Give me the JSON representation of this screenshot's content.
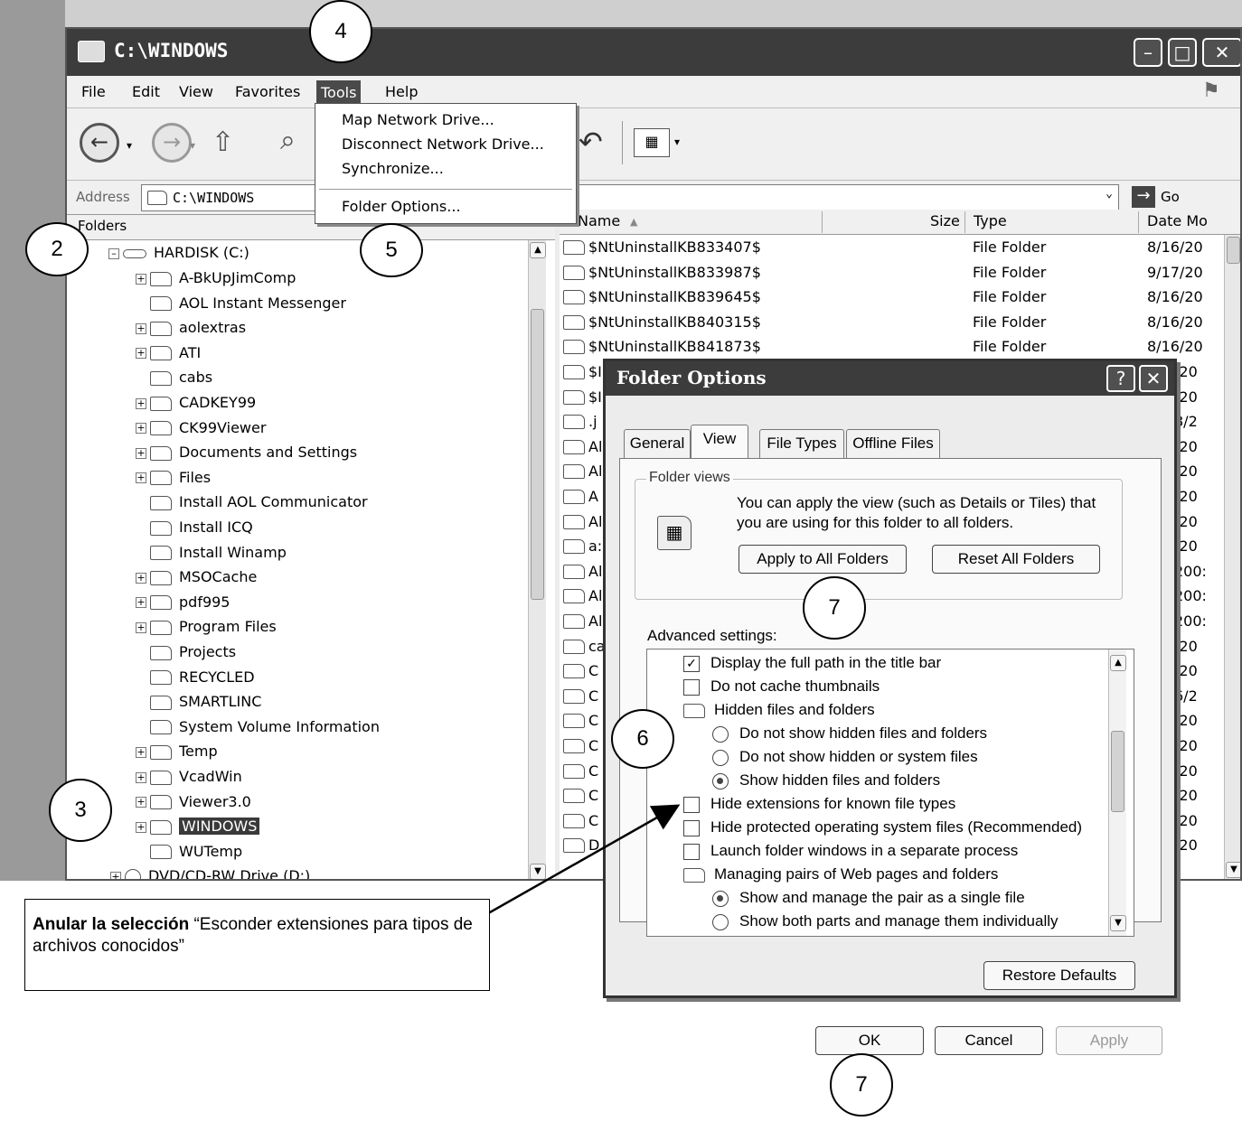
{
  "window": {
    "title": "C:\\WINDOWS"
  },
  "menu": [
    "File",
    "Edit",
    "View",
    "Favorites",
    "Tools",
    "Help"
  ],
  "address": {
    "label": "Address",
    "value": "C:\\WINDOWS",
    "go": "Go"
  },
  "tools_menu": {
    "items": [
      "Map Network Drive...",
      "Disconnect Network Drive...",
      "Synchronize...",
      "Folder Options..."
    ]
  },
  "folders": {
    "header": "Folders",
    "root": "HARDISK (C:)",
    "items": [
      "A-BkUpJimComp",
      "AOL Instant Messenger",
      "aolextras",
      "ATI",
      "cabs",
      "CADKEY99",
      "CK99Viewer",
      "Documents and Settings",
      "Files",
      "Install AOL Communicator",
      "Install ICQ",
      "Install Winamp",
      "MSOCache",
      "pdf995",
      "Program Files",
      "Projects",
      "RECYCLED",
      "SMARTLINC",
      "System Volume Information",
      "Temp",
      "VcadWin",
      "Viewer3.0",
      "WINDOWS",
      "WUTemp"
    ],
    "drive": "DVD/CD-RW Drive (D:)"
  },
  "file_list": {
    "columns": [
      "Name",
      "Size",
      "Type",
      "Date Mo"
    ],
    "rows": [
      {
        "name": "$NtUninstallKB833407$",
        "type": "File Folder",
        "date": "8/16/20"
      },
      {
        "name": "$NtUninstallKB833987$",
        "type": "File Folder",
        "date": "9/17/20"
      },
      {
        "name": "$NtUninstallKB839645$",
        "type": "File Folder",
        "date": "8/16/20"
      },
      {
        "name": "$NtUninstallKB840315$",
        "type": "File Folder",
        "date": "8/16/20"
      },
      {
        "name": "$NtUninstallKB841873$",
        "type": "File Folder",
        "date": "8/16/20"
      }
    ],
    "partial_names": [
      "$I",
      "$I",
      ".j",
      "Al",
      "Al",
      "A",
      "Al",
      "a:",
      "Al",
      "Al",
      "Al",
      "ca",
      "C",
      "C",
      "C",
      "C",
      "C",
      "C",
      "C",
      "D"
    ],
    "partial_dates": [
      "/20",
      "/20",
      "8/2",
      "/20",
      "/20",
      "/20",
      "/20",
      "/20",
      "200:",
      "200:",
      "200:",
      "/20",
      "/20",
      "6/2",
      "/20",
      "/20",
      "/20",
      "/20",
      "/20",
      "/20"
    ]
  },
  "dialog": {
    "title": "Folder Options",
    "tabs": [
      "General",
      "View",
      "File Types",
      "Offline Files"
    ],
    "folder_views": {
      "label": "Folder views",
      "text1": "You can apply the view (such as Details or Tiles) that",
      "text2": "you are using for this folder to all folders.",
      "apply_all": "Apply to All Folders",
      "reset_all": "Reset All Folders"
    },
    "advanced_label": "Advanced settings:",
    "settings": [
      "Display the full path in the title bar",
      "Do not cache thumbnails",
      "Hidden files and folders",
      "Do not show hidden files and folders",
      "Do not show hidden or system files",
      "Show hidden files and folders",
      "Hide extensions for known file types",
      "Hide protected operating system files (Recommended)",
      "Launch folder windows in a separate process",
      "Managing pairs of Web pages and folders",
      "Show and manage the pair as a single file",
      "Show both parts and manage them individually"
    ],
    "restore": "Restore Defaults",
    "ok": "OK",
    "cancel": "Cancel",
    "apply": "Apply"
  },
  "callouts": [
    "4",
    "2",
    "5",
    "3",
    "6",
    "7",
    "7"
  ],
  "note": {
    "bold": "Anular la selección",
    "text": " “Esconder extensiones para tipos de archivos conocidos”"
  }
}
